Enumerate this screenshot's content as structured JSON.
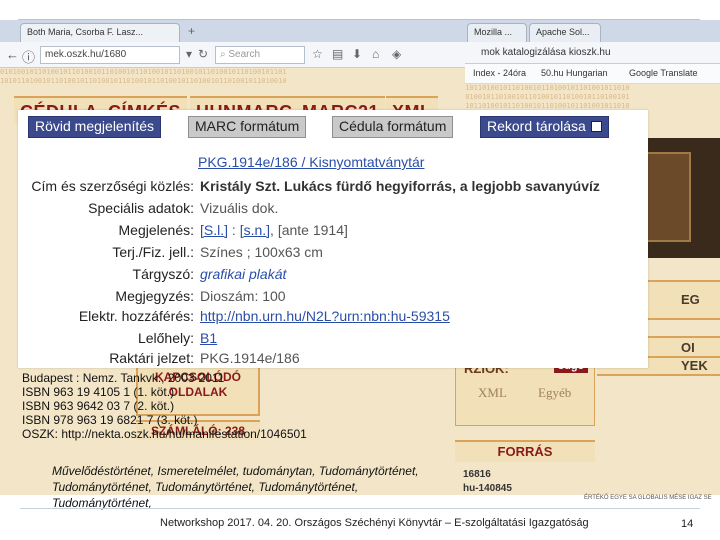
{
  "back_browser": {
    "tab1": "Mozilla ...",
    "tab2": "Apache Sol...",
    "address": "mok katalogizálása kioszk.hu",
    "bookmarks": [
      "Index - 24óra",
      "50.hu Hungarian",
      "Google Translate"
    ],
    "side_buttons": [
      "EG",
      "OI",
      "YEK"
    ],
    "kapcsolodo": "KAPCSOLÓDÓ OLDALAK",
    "szamlalo": "SZÁMLÁLÓ: 238",
    "footer_small": "ÉRTÉKŐ EGYE SA GLOBALIS MÉSE IGAZ SE"
  },
  "mid_browser": {
    "tab_title": "Both Maria, Csorba F. Lasz...",
    "url": "mek.oszk.hu/1680",
    "search_placeholder": "Search",
    "format_tabs": [
      "CÉDULA",
      "CÍMKÉS",
      "HUNMARC",
      "MARC21",
      "XML"
    ],
    "versions_label": "RZIÓK:",
    "sugo": "súgó",
    "version_links": [
      "XML",
      "Egyéb"
    ],
    "forras": "FORRÁS",
    "id_codes": [
      "16816",
      "hu-140845"
    ]
  },
  "popup": {
    "buttons": {
      "rovid": "Rövid megjelenítés",
      "marc": "MARC formátum",
      "cedula": "Cédula formátum",
      "rekord": "Rekord tárolása"
    },
    "record_link": "PKG.1914e/186 / Kisnyomtatványtár",
    "fields": [
      {
        "label": "Cím és szerzőségi közlés:",
        "value": "Kristály Szt. Lukács fürdő hegyiforrás, a legjobb savanyúvíz"
      },
      {
        "label": "Speciális adatok:",
        "value": "Vizuális dok."
      },
      {
        "label": "Megjelenés:",
        "value_parts": [
          "[S.l.]",
          " : ",
          "[s.n.]",
          ", [ante 1914]"
        ]
      },
      {
        "label": "Terj./Fiz. jell.:",
        "value": "Színes ; 100x63 cm"
      },
      {
        "label": "Tárgyszó:",
        "value": "grafikai plakát"
      },
      {
        "label": "Megjegyzés:",
        "value": "Dioszám: 100"
      },
      {
        "label": "Elektr. hozzáférés:",
        "value": "http://nbn.urn.hu/N2L?urn:nbn:hu-59315"
      },
      {
        "label": "Lelőhely:",
        "value": "B1"
      },
      {
        "label": "Raktári jelzet:",
        "value": "PKG.1914e/186"
      }
    ]
  },
  "lower": {
    "lines": [
      "Budapest : Nemz. Tankvk., 2003-2011",
      "ISBN 963 19 4105 1 (1. köt.)",
      "ISBN 963 9642 03 7 (2. köt.)",
      "ISBN 978 963 19 6821 7 (3. köt.)",
      "OSZK: http://nekta.oszk.hu/hu/manifestation/1046501"
    ],
    "subjects1": "Művelődéstörténet, Ismeretelmélet, tudománytan, Tudománytörténet,",
    "subjects2": "Tudománytörténet, Tudománytörténet, Tudománytörténet, Tudománytörténet,"
  },
  "footer": {
    "text": "Networkshop 2017. 04. 20. Országos Széchényi Könyvtár – E-szolgáltatási Igazgatóság",
    "page": "14"
  }
}
